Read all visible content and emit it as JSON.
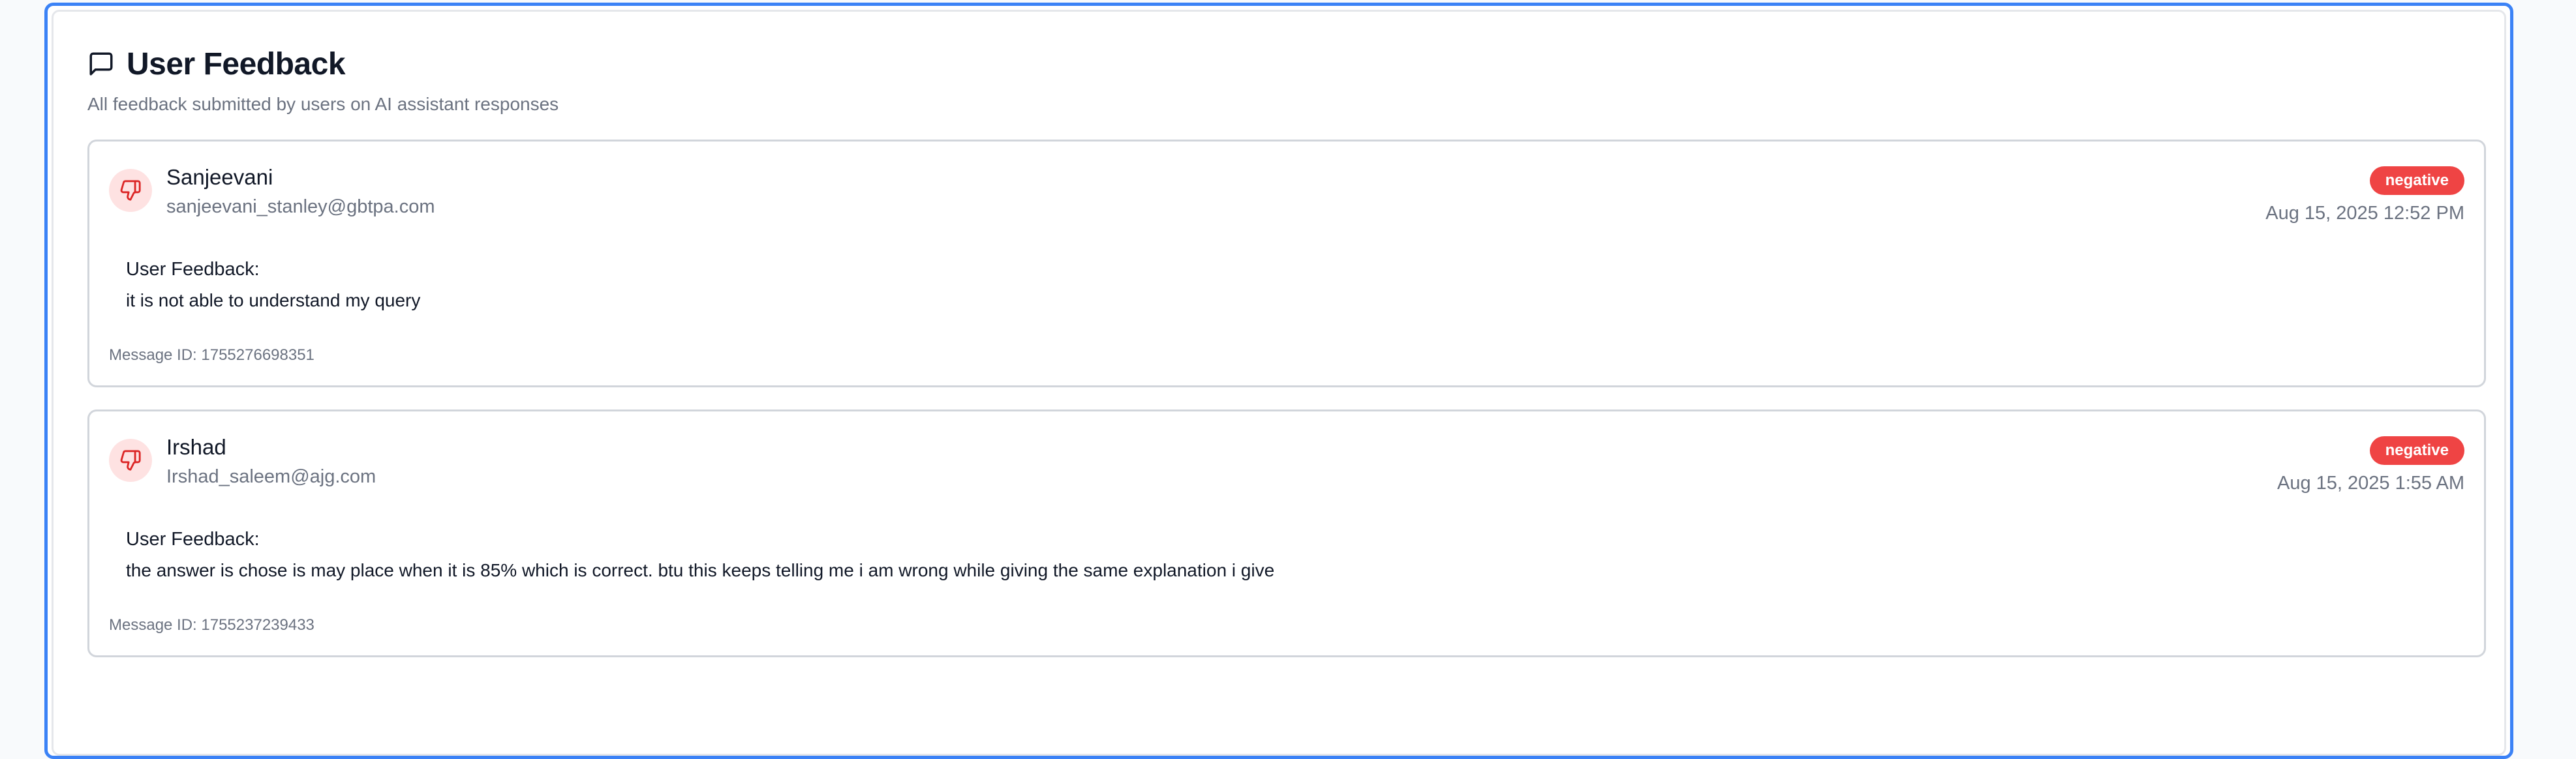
{
  "header": {
    "icon": "message-square-icon",
    "title": "User Feedback",
    "subtitle": "All feedback submitted by users on AI assistant responses"
  },
  "feedback": [
    {
      "name": "Sanjeevani",
      "email": "sanjeevani_stanley@gbtpa.com",
      "sentiment": "negative",
      "timestamp": "Aug 15, 2025 12:52 PM",
      "label": "User Feedback:",
      "text": "it is not able to understand my query",
      "message_id": "Message ID: 1755276698351",
      "icon": "thumbs-down-icon"
    },
    {
      "name": "Irshad",
      "email": "Irshad_saleem@ajg.com",
      "sentiment": "negative",
      "timestamp": "Aug 15, 2025 1:55 AM",
      "label": "User Feedback:",
      "text": "the answer is chose is may place when it is 85% which is correct. btu this keeps telling me i am wrong while giving the same explanation i give",
      "message_id": "Message ID: 1755237239433",
      "icon": "thumbs-down-icon"
    }
  ],
  "colors": {
    "accent_border": "#3b82f6",
    "negative_badge": "#ef4444",
    "avatar_bg": "#fee2e2",
    "muted_text": "#6b7280"
  }
}
